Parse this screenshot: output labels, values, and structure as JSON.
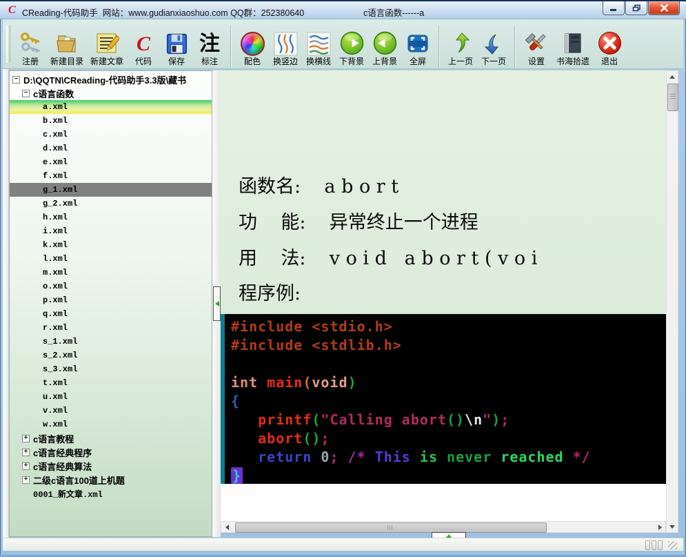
{
  "window": {
    "logo_letter": "C",
    "title": "CReading-代码助手  网站：www.gudianxiaoshuo.com QQ群：252380640",
    "doc_title": "c语言函数------a"
  },
  "toolbar": {
    "groups": [
      {
        "buttons": [
          {
            "label": "注册",
            "icon": "keys-icon"
          },
          {
            "label": "新建目录",
            "icon": "new-folder-icon"
          },
          {
            "label": "新建文章",
            "icon": "new-article-icon"
          },
          {
            "label": "代码",
            "icon": "code-c-icon"
          },
          {
            "label": "保存",
            "icon": "save-icon"
          },
          {
            "label": "标注",
            "icon": "annotate-icon"
          }
        ]
      },
      {
        "buttons": [
          {
            "label": "配色",
            "icon": "palette-icon"
          },
          {
            "label": "换竖边",
            "icon": "vertical-waves-icon"
          },
          {
            "label": "换横线",
            "icon": "horizontal-waves-icon"
          },
          {
            "label": "下背景",
            "icon": "next-background-icon"
          },
          {
            "label": "上背景",
            "icon": "prev-background-icon"
          },
          {
            "label": "全屏",
            "icon": "fullscreen-icon"
          }
        ]
      },
      {
        "buttons": [
          {
            "label": "上一页",
            "icon": "prev-page-icon"
          },
          {
            "label": "下一页",
            "icon": "next-page-icon"
          }
        ]
      },
      {
        "buttons": [
          {
            "label": "设置",
            "icon": "settings-icon"
          },
          {
            "label": "书海拾遗",
            "icon": "books-icon"
          },
          {
            "label": "退出",
            "icon": "exit-icon"
          }
        ]
      }
    ]
  },
  "tree": {
    "items": [
      {
        "label": "D:\\QQTN\\CReading-代码助手3.3版\\藏书",
        "indent": 0,
        "expander": "minus",
        "bold": true
      },
      {
        "label": "c语言函数",
        "indent": 1,
        "expander": "minus",
        "bold": true
      },
      {
        "label": "a.xml",
        "indent": 2,
        "sel": "gradient"
      },
      {
        "label": "b.xml",
        "indent": 2
      },
      {
        "label": "c.xml",
        "indent": 2
      },
      {
        "label": "d.xml",
        "indent": 2
      },
      {
        "label": "e.xml",
        "indent": 2
      },
      {
        "label": "f.xml",
        "indent": 2
      },
      {
        "label": "g_1.xml",
        "indent": 2,
        "sel": "gray"
      },
      {
        "label": "g_2.xml",
        "indent": 2
      },
      {
        "label": "h.xml",
        "indent": 2
      },
      {
        "label": "i.xml",
        "indent": 2
      },
      {
        "label": "k.xml",
        "indent": 2
      },
      {
        "label": "l.xml",
        "indent": 2
      },
      {
        "label": "m.xml",
        "indent": 2
      },
      {
        "label": "o.xml",
        "indent": 2
      },
      {
        "label": "p.xml",
        "indent": 2
      },
      {
        "label": "q.xml",
        "indent": 2
      },
      {
        "label": "r.xml",
        "indent": 2
      },
      {
        "label": "s_1.xml",
        "indent": 2
      },
      {
        "label": "s_2.xml",
        "indent": 2
      },
      {
        "label": "s_3.xml",
        "indent": 2
      },
      {
        "label": "t.xml",
        "indent": 2
      },
      {
        "label": "u.xml",
        "indent": 2
      },
      {
        "label": "v.xml",
        "indent": 2
      },
      {
        "label": "w.xml",
        "indent": 2
      },
      {
        "label": "c语言教程",
        "indent": 1,
        "expander": "plus",
        "bold": true
      },
      {
        "label": "c语言经典程序",
        "indent": 1,
        "expander": "plus",
        "bold": true
      },
      {
        "label": "c语言经典算法",
        "indent": 1,
        "expander": "plus",
        "bold": true
      },
      {
        "label": "二级c语言100道上机题",
        "indent": 1,
        "expander": "plus",
        "bold": true
      },
      {
        "label": "0001_新文章.xml",
        "indent": 1
      }
    ]
  },
  "content": {
    "lines": [
      "函数名:    a b o r t",
      "功    能:    异常终止一个进程",
      "用    法:    v o i d   a b o r t ( v o i",
      "程序例:"
    ]
  },
  "code": {
    "background": "#010101",
    "left_border": "#0e7c8c",
    "lines": [
      [
        {
          "t": "#include <stdio.h>",
          "c": "#b43c16"
        }
      ],
      [
        {
          "t": "#include <stdlib.h>",
          "c": "#b43c16"
        }
      ],
      [],
      [
        {
          "t": "int ",
          "c": "#e09078"
        },
        {
          "t": "main",
          "c": "#e62b18"
        },
        {
          "t": "(",
          "c": "#e06a2a"
        },
        {
          "t": "void",
          "c": "#e0a080"
        },
        {
          "t": ")",
          "c": "#1fa636"
        }
      ],
      [
        {
          "t": "{",
          "c": "#2a66a8"
        }
      ],
      [
        {
          "t": "   ",
          "c": "#ffffff"
        },
        {
          "t": "printf",
          "c": "#e62b18"
        },
        {
          "t": "(",
          "c": "#1fa636"
        },
        {
          "t": "\"Calling abort",
          "c": "#b22a5e"
        },
        {
          "t": "()",
          "c": "#1fa636"
        },
        {
          "t": "\\n",
          "c": "#e8e8ee"
        },
        {
          "t": "\"",
          "c": "#b22a5e"
        },
        {
          "t": ")",
          "c": "#1fa636"
        },
        {
          "t": ";",
          "c": "#c22470"
        }
      ],
      [
        {
          "t": "   ",
          "c": "#ffffff"
        },
        {
          "t": "abort",
          "c": "#e62b18"
        },
        {
          "t": "()",
          "c": "#1fa636"
        },
        {
          "t": ";",
          "c": "#c22470"
        }
      ],
      [
        {
          "t": "   ",
          "c": "#ffffff"
        },
        {
          "t": "return",
          "c": "#3a44c8"
        },
        {
          "t": " 0",
          "c": "#9aa2b2"
        },
        {
          "t": ";",
          "c": "#c22470"
        },
        {
          "t": " /* ",
          "c": "#a62ba6"
        },
        {
          "t": "This",
          "c": "#5a38d8"
        },
        {
          "t": " is ",
          "c": "#22c94e"
        },
        {
          "t": "never",
          "c": "#1ba03c"
        },
        {
          "t": " reached ",
          "c": "#2ad95e"
        },
        {
          "t": "*/",
          "c": "#c22470"
        }
      ],
      [
        {
          "t": "}",
          "c": "#28d0d0",
          "cursor": true
        }
      ]
    ]
  },
  "colors": {
    "selected_gradient_top": "#3ecb6c",
    "selected_gradient_bottom": "#f2ee55",
    "selected_gray": "#808080",
    "titlebar_accent": "#b4cfe9",
    "toolbar_background": "#d3e5e0"
  }
}
